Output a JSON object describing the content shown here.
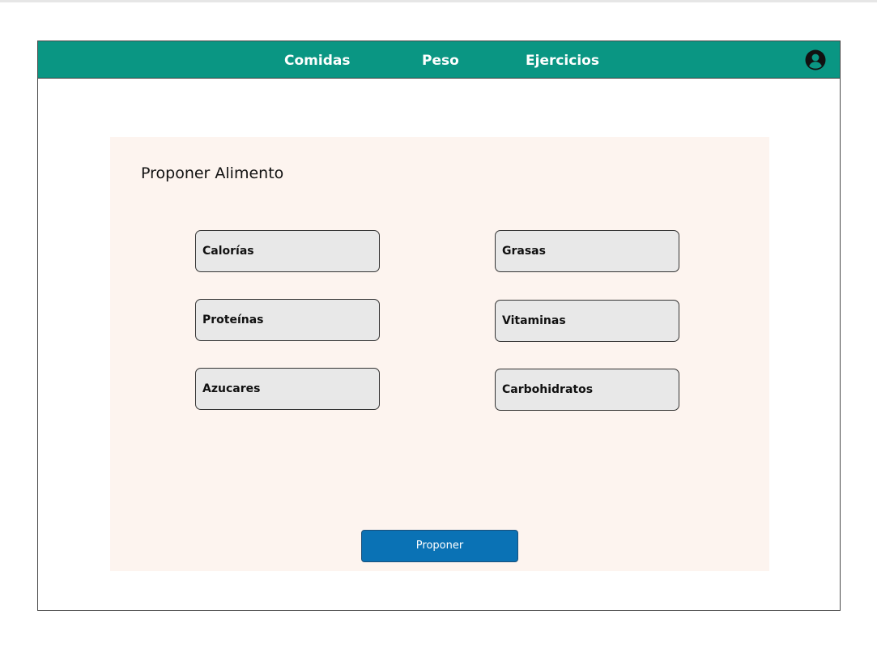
{
  "nav": {
    "links": [
      "Comidas",
      "Peso",
      "Ejercicios"
    ],
    "user_icon": "user-circle-icon",
    "background_color": "#0a9683"
  },
  "form": {
    "title": "Proponer Alimento",
    "fields": {
      "calorias": "Calorías",
      "proteinas": "Proteínas",
      "azucares": "Azucares",
      "grasas": "Grasas",
      "vitaminas": "Vitaminas",
      "carbohidratos": "Carbohidratos"
    },
    "submit_label": "Proponer",
    "submit_color": "#0a72b5",
    "panel_color": "#fdf4ef"
  }
}
